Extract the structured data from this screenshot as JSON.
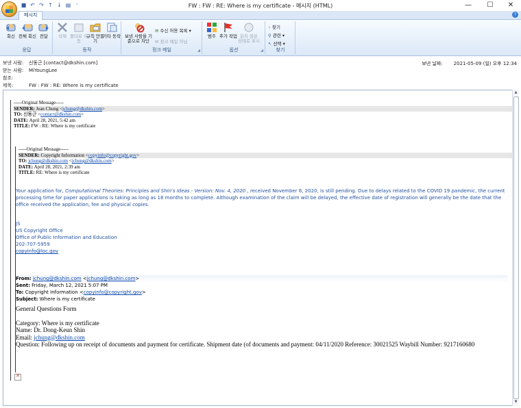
{
  "window": {
    "title": "FW : FW : RE: Where is my certificate - 메시지 (HTML)",
    "minimize_glyph": "—",
    "maximize_glyph": "☐",
    "close_glyph": "✕"
  },
  "quick_access": [
    "save-icon",
    "undo-icon",
    "redo-icon",
    "up-arrow-icon",
    "down-arrow-icon",
    "print-icon"
  ],
  "tabs": [
    {
      "label": "메시지",
      "active": true
    }
  ],
  "ribbon": {
    "groups": [
      {
        "caption": "응답",
        "buttons": [
          {
            "label": "회신",
            "icon": "reply-icon"
          },
          {
            "label": "전체 회신",
            "icon": "reply-all-icon"
          },
          {
            "label": "전달",
            "icon": "forward-icon"
          }
        ]
      },
      {
        "caption": "동작",
        "buttons": [
          {
            "label": "삭제",
            "icon": "delete-icon",
            "disabled": true
          },
          {
            "label": "폴더로 이동",
            "icon": "move-folder-icon",
            "disabled": true
          },
          {
            "label": "규칙 만들기",
            "icon": "rules-icon"
          },
          {
            "label": "기타 동작",
            "icon": "other-actions-icon"
          }
        ]
      },
      {
        "caption": "정크 메일",
        "buttons": [
          {
            "label": "보낸 사람을 기준으로 차단",
            "icon": "block-sender-icon"
          }
        ],
        "small": [
          {
            "label": "수신 허용 목록",
            "icon": "safe-list-icon"
          },
          {
            "label": "정크 메일 아님",
            "icon": "not-junk-icon",
            "disabled": true
          }
        ]
      },
      {
        "caption": "옵션",
        "buttons": [
          {
            "label": "범주",
            "icon": "categorize-icon"
          },
          {
            "label": "추가 작업",
            "icon": "follow-up-flag-icon"
          },
          {
            "label": "읽지 않은 상태로 표시",
            "icon": "mark-unread-icon",
            "disabled": true
          }
        ]
      },
      {
        "caption": "찾기",
        "small": [
          {
            "label": "찾기",
            "icon": "find-icon"
          },
          {
            "label": "관련",
            "icon": "related-icon"
          },
          {
            "label": "선택",
            "icon": "select-icon"
          }
        ]
      }
    ]
  },
  "header": {
    "from_label": "보낸 사람:",
    "from_value": "신동근 [contact@dkshin.com]",
    "to_label": "받는 사람:",
    "to_value": "MiYoungLee",
    "cc_label": "참조:",
    "cc_value": "",
    "subject_label": "제목:",
    "subject_value": "FW : FW : RE: Where is my certificate",
    "sent_label": "보낸 날짜:",
    "sent_value": "2021-05-09 (일) 오후 12:34"
  },
  "message": {
    "orig1": {
      "divider": "-----Original Message-----",
      "sender_label": "SENDER:",
      "sender_name": "Jean Chung <",
      "sender_email": "jchung@dkshin.com",
      "sender_close": ">",
      "to_label": "TO:",
      "to_name": "신동근 <",
      "to_email": "contact@dkshin.com",
      "to_close": ">",
      "date_label": "DATE:",
      "date_value": "April 28, 2021, 5:42 am",
      "title_label": "TITLE:",
      "title_value": "FW : RE: Where is my certificate"
    },
    "orig2": {
      "divider": "-----Original Message-----",
      "sender_label": "SENDER:",
      "sender_name": "Copyright Information <",
      "sender_email": "copyinfo@copyright.gov",
      "sender_close": ">",
      "to_label": "TO:",
      "to_email1": "jchung@dkshin.com",
      "to_email2": "jchung@dkshin.com",
      "date_label": "DATE:",
      "date_value": "April 28, 2021, 2:39 am",
      "title_label": "TITLE:",
      "title_value": "RE: Where is my certificate"
    },
    "application": {
      "prefix": "Your application for, ",
      "work_title": "Computational Theories: Principles and Shin's Ideas - Version: Nov. 4, 2020",
      "suffix": " , received November 6, 2020, is still pending. Due to delays related to the COVID 19 pandemic, the current processing time for paper applications is taking as long as 18 months to complete. Although examination of the claim will be delayed, the effective date of registration will generally be the date that the office received the application, fee and physical copies."
    },
    "signature": {
      "initials": "JS",
      "office": "US Copyright Office",
      "dept": "Office of Public Information and Education",
      "phone": "202-707-5959",
      "email": "copyinfo@loc.gov"
    },
    "forward": {
      "from_label": "From:",
      "from_email1": "jchung@dkshin.com",
      "from_email2": "jchung@dkshin.com",
      "sent_label": "Sent:",
      "sent_value": "Friday, March 12, 2021 5:07 PM",
      "to_label": "To:",
      "to_name": "Copyright Information <",
      "to_email": "copyinfo@copyright.gov",
      "subject_label": "Subject:",
      "subject_value": "Where is my certificate"
    },
    "form": {
      "heading": "General Questions Form",
      "category": "Category: Where is my certificate",
      "name": "Name: Dr. Dong-Keun Shin",
      "email_label": "Email: ",
      "email": "jchung@dkshin.com",
      "question": "Question: Following up on receipt of documents and payment for certificate. Shipment date (of documents and payment: 04/11/2020 Reference: 30021525 Waybill Number: 9217160680"
    }
  }
}
